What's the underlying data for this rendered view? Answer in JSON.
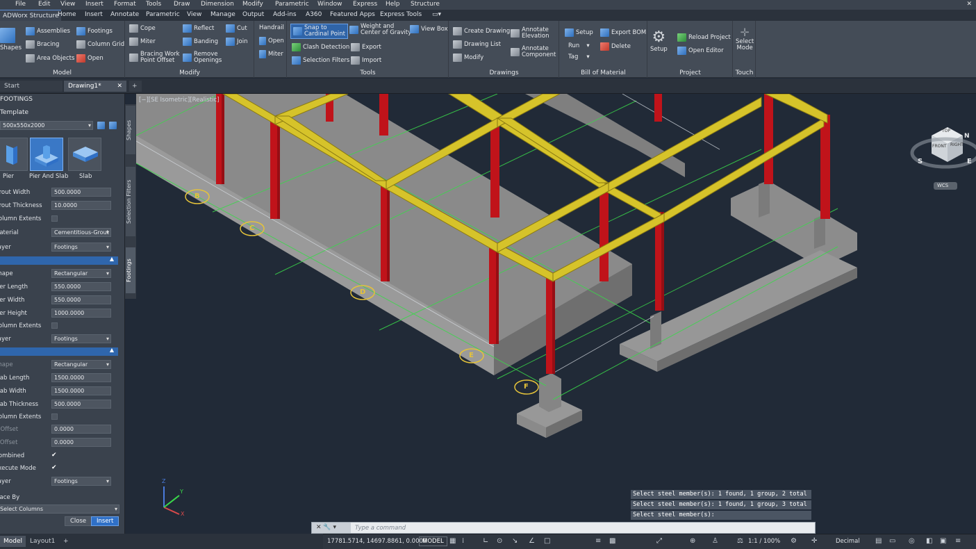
{
  "menu": [
    "File",
    "Edit",
    "View",
    "Insert",
    "Format",
    "Tools",
    "Draw",
    "Dimension",
    "Modify",
    "Parametric",
    "Window",
    "Express",
    "Help",
    "Structure"
  ],
  "ribbon_tabs": [
    "ADWorx Structure",
    "Home",
    "Insert",
    "Annotate",
    "Parametric",
    "View",
    "Manage",
    "Output",
    "Add-ins",
    "A360",
    "Featured Apps",
    "Express Tools"
  ],
  "panels": {
    "model": {
      "title": "Model",
      "shapes": "Shapes",
      "assemblies": "Assemblies",
      "footings": "Footings",
      "bracing": "Bracing",
      "column_grid": "Column Grid",
      "area_objects": "Area Objects",
      "open": "Open"
    },
    "modify": {
      "title": "Modify",
      "cope": "Cope",
      "reflect": "Reflect",
      "cut": "Cut",
      "miter": "Miter",
      "banding": "Banding",
      "join": "Join",
      "bracing_work_1": "Bracing Work",
      "bracing_work_2": "Point Offset",
      "remove_1": "Remove",
      "remove_2": "Openings"
    },
    "handrail": {
      "handrail": "Handrail",
      "open": "Open",
      "miter": "Miter"
    },
    "tools": {
      "title": "Tools",
      "snap_1": "Snap to",
      "snap_2": "Cardinal Point",
      "weight_1": "Weight and",
      "weight_2": "Center of Gravity",
      "view_box": "View Box",
      "clash": "Clash Detection",
      "export": "Export",
      "selection_filters": "Selection Filters",
      "import": "Import"
    },
    "drawings": {
      "title": "Drawings",
      "create_drawing": "Create Drawing",
      "annotate_elev_1": "Annotate",
      "annotate_elev_2": "Elevation",
      "drawing_list": "Drawing List",
      "annotate_comp_1": "Annotate",
      "annotate_comp_2": "Component",
      "modify": "Modify"
    },
    "bom": {
      "title": "Bill of Material",
      "setup": "Setup",
      "export_bom": "Export BOM",
      "run": "Run",
      "delete": "Delete",
      "tag": "Tag"
    },
    "project": {
      "title": "Project",
      "setup": "Setup",
      "reload": "Reload Project",
      "open_editor": "Open Editor"
    },
    "touch": {
      "title": "Touch",
      "select_1": "Select",
      "select_2": "Mode"
    }
  },
  "doc_tabs": [
    "Start",
    "Drawing1*"
  ],
  "left_panel": {
    "title": "FOOTINGS",
    "template_label": "Template",
    "template_value": "500x550x2000",
    "tiles": [
      "Pier",
      "Pier And Slab",
      "Slab"
    ],
    "rows1": [
      {
        "label": "Grout Width",
        "value": "500.0000"
      },
      {
        "label": "Grout Thickness",
        "value": "10.0000"
      }
    ],
    "column_extents_label": "Column Extents",
    "material_label": "Material",
    "material_value": "Cementitious-Grout",
    "layer_label": "Layer",
    "layer_value": "Footings",
    "pier_rows": [
      {
        "label": "Shape",
        "value": "Rectangular"
      },
      {
        "label": "Pier Length",
        "value": "550.0000"
      },
      {
        "label": "Pier Width",
        "value": "550.0000"
      },
      {
        "label": "Pier Height",
        "value": "1000.0000"
      }
    ],
    "slab_rows": [
      {
        "label": "Shape",
        "value": "Rectangular"
      },
      {
        "label": "Slab Length",
        "value": "1500.0000"
      },
      {
        "label": "Slab Width",
        "value": "1500.0000"
      },
      {
        "label": "Slab Thickness",
        "value": "500.0000"
      }
    ],
    "x_offset_label": "X Offset",
    "x_offset_value": "0.0000",
    "y_offset_label": "Y Offset",
    "y_offset_value": "0.0000",
    "combined_label": "Combined",
    "execute_label": "Execute Mode",
    "place_by_label": "Place By",
    "place_by_value": "Select Columns",
    "close": "Close",
    "insert": "Insert"
  },
  "vtabs": [
    "Shapes",
    "Selection Filters",
    "Footings"
  ],
  "viewport": {
    "label": "[−][SE Isometric][Realistic]",
    "grid_labels": [
      "B",
      "C",
      "D",
      "E",
      "F"
    ],
    "viewcube_top": "TOP",
    "viewcube_front": "FRONT",
    "viewcube_right": "RIGHT",
    "compass_s": "S",
    "compass_e": "E",
    "compass_n": "N",
    "wcs": "WCS",
    "axis_z": "Z",
    "axis_y": "Y",
    "axis_x": "X"
  },
  "command": {
    "history": [
      "Select steel member(s): 1 found, 1 group, 2 total",
      "Select steel member(s): 1 found, 1 group, 3 total",
      "Select steel member(s):"
    ],
    "placeholder": "Type a command"
  },
  "layout_tabs": [
    "Model",
    "Layout1"
  ],
  "status": {
    "coords": "17781.5714, 14697.8861, 0.0000",
    "model": "MODEL",
    "scale": "1:1 / 100%",
    "units": "Decimal"
  },
  "colors": {
    "column": "#c0131a",
    "beam": "#d6c32a",
    "concrete": "#8f8f8f",
    "grid": "#3ad84a",
    "accent": "#2f70c7"
  }
}
